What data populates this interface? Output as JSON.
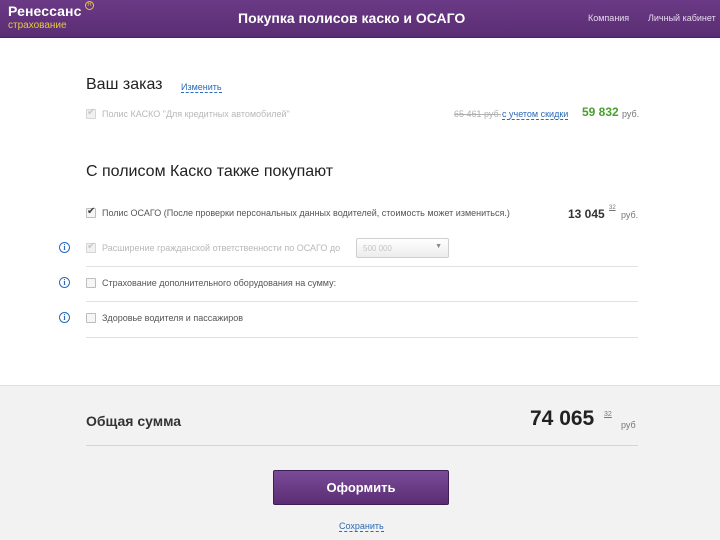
{
  "header": {
    "logo_main": "Ренессанс",
    "logo_sub": "страхование",
    "logo_mark": "R",
    "title": "Покупка полисов каско и ОСАГО",
    "links": [
      "Компания",
      "Личный кабинет"
    ]
  },
  "order": {
    "title": "Ваш заказ",
    "edit_link": "Изменить",
    "kasko": {
      "label": "Полис КАСКО \"Для кредитных автомобилей\"",
      "old_price": "65 461 руб.",
      "discount_link": "с учетом скидки",
      "price": "59 832",
      "unit": "руб."
    }
  },
  "also": {
    "title": "С полисом Каско также покупают",
    "items": [
      {
        "label": "Полис ОСАГО (После проверки персональных данных водителей, стоимость может измениться.)",
        "checked": true,
        "price": "13 045",
        "kop": "32",
        "unit": "руб."
      },
      {
        "label": "Расширение гражданской ответственности по ОСАГО до",
        "checked": true,
        "select_value": "500 000"
      },
      {
        "label": "Страхование дополнительного оборудования на сумму:",
        "checked": false
      },
      {
        "label": "Здоровье водителя и пассажиров",
        "checked": false
      }
    ]
  },
  "summary": {
    "label": "Общая сумма",
    "value": "74 065",
    "kop": "32",
    "unit": "руб",
    "button": "Оформить",
    "save_link": "Сохранить"
  },
  "colors": {
    "header": "#5a2d73",
    "accent_green": "#4aa02c",
    "link_blue": "#2b6ab7",
    "logo_yellow": "#e8c840"
  },
  "icons": {
    "checkbox_mark": "check-icon",
    "info": "info-icon",
    "dropdown": "chevron-down-icon"
  }
}
